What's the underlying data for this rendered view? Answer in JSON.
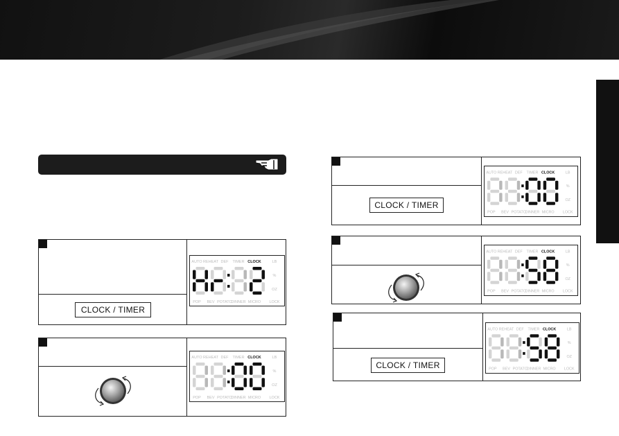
{
  "colors": {
    "header": "#151515",
    "lcd_active": "#111111",
    "lcd_ghost": "#d4d4d4",
    "lcd_label": "#bbbbbb",
    "lcd_label_active": "#111111"
  },
  "button_label": "CLOCK / TIMER",
  "lcd_labels": {
    "top": [
      "AUTO",
      "REHEAT",
      "DEF",
      "TIMER",
      "CLOCK",
      "LB"
    ],
    "right": [
      "%",
      "OZ"
    ],
    "bottom": [
      "POP",
      "BEV",
      "POTATO",
      "DINNER",
      "MICRO",
      "LOCK"
    ],
    "active": "CLOCK"
  },
  "displays": [
    {
      "chars": [
        "H",
        "r",
        "1",
        "2"
      ],
      "active": [
        true,
        true,
        false,
        true
      ]
    },
    {
      "chars": [
        "1",
        "1",
        "0",
        "0"
      ],
      "active": [
        false,
        false,
        true,
        true
      ]
    },
    {
      "chars": [
        "1",
        "1",
        "0",
        "0"
      ],
      "active": [
        false,
        false,
        true,
        true
      ]
    },
    {
      "chars": [
        "1",
        "1",
        "5",
        "8"
      ],
      "active": [
        false,
        false,
        true,
        true
      ]
    },
    {
      "chars": [
        "1",
        "1",
        "5",
        "8"
      ],
      "active": [
        false,
        false,
        true,
        true
      ]
    }
  ],
  "icons": {
    "bar": "pointing-hand-icon",
    "knob": "dial-knob-icon"
  }
}
